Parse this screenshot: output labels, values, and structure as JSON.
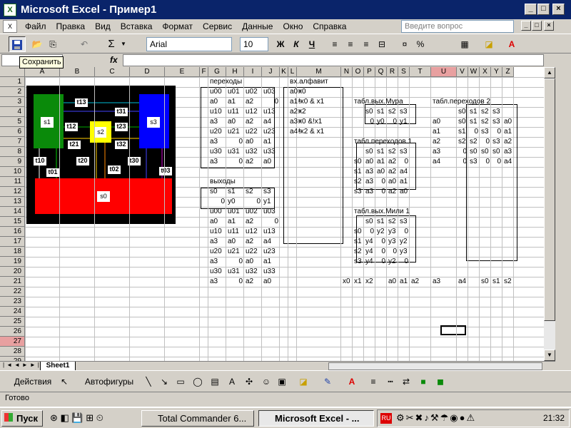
{
  "window": {
    "title": "Microsoft Excel - Пример1"
  },
  "menu": {
    "items": [
      "Файл",
      "Правка",
      "Вид",
      "Вставка",
      "Формат",
      "Сервис",
      "Данные",
      "Окно",
      "Справка"
    ],
    "help_placeholder": "Введите вопрос"
  },
  "toolbar": {
    "font": "Arial",
    "size": "10",
    "bold": "Ж",
    "italic": "К",
    "underline": "Ч",
    "percent": "%",
    "sigma": "Σ",
    "tooltip": "Сохранить"
  },
  "formula": {
    "fx": "fx"
  },
  "columns": [
    "A",
    "B",
    "C",
    "D",
    "E",
    "F",
    "G",
    "H",
    "I",
    "J",
    "K",
    "L",
    "M",
    "N",
    "O",
    "P",
    "Q",
    "R",
    "S",
    "T",
    "U",
    "V",
    "W",
    "X",
    "Y",
    "Z"
  ],
  "rows": [
    "1",
    "2",
    "3",
    "4",
    "5",
    "6",
    "7",
    "8",
    "9",
    "10",
    "11",
    "12",
    "13",
    "14",
    "15",
    "16",
    "17",
    "18",
    "19",
    "20",
    "21",
    "22",
    "23",
    "24",
    "25",
    "26",
    "27",
    "28",
    "29",
    "30"
  ],
  "selected": {
    "col": "U",
    "row": "27"
  },
  "diagram": {
    "states": [
      "s1",
      "s2",
      "s3",
      "s0"
    ],
    "labels": [
      "t13",
      "t31",
      "t12",
      "t23",
      "t21",
      "t32",
      "t10",
      "t20",
      "t30",
      "t01",
      "t02",
      "t03"
    ]
  },
  "sheet": {
    "perekhody": {
      "title": "переходы",
      "rows": [
        [
          "u00",
          "u01",
          "u02",
          "u03"
        ],
        [
          "a0",
          "a1",
          "a2",
          "0"
        ],
        [
          "u10",
          "u11",
          "u12",
          "u13"
        ],
        [
          "a3",
          "a0",
          "a2",
          "a4"
        ],
        [
          "u20",
          "u21",
          "u22",
          "u23"
        ],
        [
          "a3",
          "0",
          "a0",
          "a1"
        ],
        [
          "u30",
          "u31",
          "u32",
          "u33"
        ],
        [
          "a3",
          "0",
          "a2",
          "a0"
        ]
      ]
    },
    "vykhody": {
      "title": "выходы",
      "header": [
        "s0",
        "s1",
        "s2",
        "s3"
      ],
      "vals": [
        "0",
        "y0",
        "0",
        "y1"
      ],
      "rows": [
        [
          "u00",
          "u01",
          "u02",
          "u03"
        ],
        [
          "a0",
          "a1",
          "a2",
          "0"
        ],
        [
          "u10",
          "u11",
          "u12",
          "u13"
        ],
        [
          "a3",
          "a0",
          "a2",
          "a4"
        ],
        [
          "u20",
          "u21",
          "u22",
          "u23"
        ],
        [
          "a3",
          "0",
          "a0",
          "a1"
        ],
        [
          "u30",
          "u31",
          "u32",
          "u33"
        ],
        [
          "a3",
          "0",
          "a2",
          "a0"
        ]
      ]
    },
    "alfavit": {
      "title": "вх.алфавит",
      "rows": [
        [
          "a0=",
          "x0"
        ],
        [
          "a1=",
          "!x0 & x1"
        ],
        [
          "a2=",
          "x2"
        ],
        [
          "a3=",
          "x0 &!x1"
        ],
        [
          "a4=",
          "!x2 & x1"
        ]
      ]
    },
    "moore": {
      "title": "табл.вых.Мура",
      "header": [
        "s0",
        "s1",
        "s2",
        "s3"
      ],
      "vals": [
        "0",
        "y0",
        "0",
        "y1"
      ]
    },
    "trans1": {
      "title": "табл.переходов 1",
      "header": [
        "s0",
        "s1",
        "s2",
        "s3"
      ],
      "rows": [
        [
          "s0",
          "a0",
          "a1",
          "a2",
          "0"
        ],
        [
          "s1",
          "a3",
          "a0",
          "a2",
          "a4"
        ],
        [
          "s2",
          "a3",
          "0",
          "a0",
          "a1"
        ],
        [
          "s3",
          "a3",
          "0",
          "a2",
          "a0"
        ]
      ]
    },
    "mealy": {
      "title": "табл.вых.Мили 1",
      "header": [
        "s0",
        "s1",
        "s2",
        "s3"
      ],
      "rows": [
        [
          "s0",
          "0",
          "y2",
          "y3",
          "0"
        ],
        [
          "s1",
          "y4",
          "0",
          "y3",
          "y2"
        ],
        [
          "s2",
          "y4",
          "0",
          "0",
          "y3"
        ],
        [
          "s3",
          "y4",
          "0",
          "y2",
          "0"
        ]
      ]
    },
    "trans2": {
      "title": "табл.переходов 2",
      "header": [
        "s0",
        "s1",
        "s2",
        "s3"
      ],
      "rows": [
        [
          "a0",
          "s0",
          "s1",
          "s2",
          "s3",
          "a0"
        ],
        [
          "a1",
          "s1",
          "0",
          "s3",
          "0",
          "a1"
        ],
        [
          "a2",
          "s2",
          "s2",
          "0",
          "s3",
          "a2"
        ],
        [
          "a3",
          "0",
          "s0",
          "s0",
          "s0",
          "a3"
        ],
        [
          "a4",
          "0",
          "s3",
          "0",
          "0",
          "a4"
        ]
      ]
    },
    "row21": [
      "x0",
      "x1",
      "x2",
      "a0",
      "a1",
      "a2",
      "a3",
      "a4",
      "s0",
      "s1",
      "s2"
    ]
  },
  "sheettab": "Sheet1",
  "drawbar": {
    "actions": "Действия",
    "autoshapes": "Автофигуры"
  },
  "status": "Готово",
  "taskbar": {
    "start": "Пуск",
    "tasks": [
      "Total Commander 6...",
      "Microsoft Excel - ..."
    ],
    "tray_lang": "RU",
    "clock": "21:32"
  }
}
